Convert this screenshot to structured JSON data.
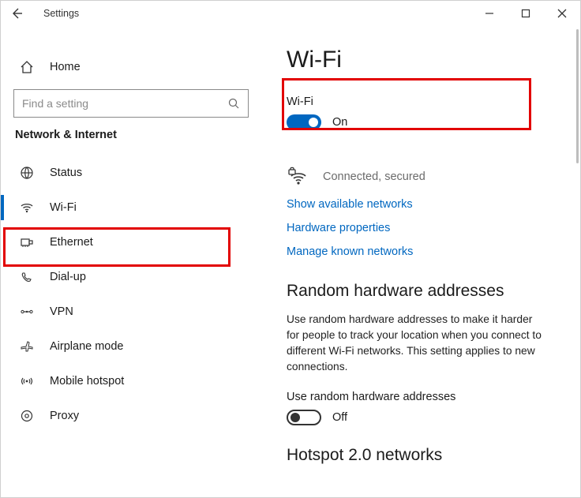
{
  "window": {
    "title": "Settings"
  },
  "sidebar": {
    "home": "Home",
    "search_placeholder": "Find a setting",
    "section": "Network & Internet",
    "items": [
      {
        "label": "Status"
      },
      {
        "label": "Wi-Fi",
        "active": true
      },
      {
        "label": "Ethernet"
      },
      {
        "label": "Dial-up"
      },
      {
        "label": "VPN"
      },
      {
        "label": "Airplane mode"
      },
      {
        "label": "Mobile hotspot"
      },
      {
        "label": "Proxy"
      }
    ]
  },
  "page": {
    "title": "Wi-Fi",
    "wifi_toggle": {
      "label": "Wi-Fi",
      "state_text": "On",
      "on": true
    },
    "connection_status": "Connected, secured",
    "links": {
      "show_networks": "Show available networks",
      "hw_props": "Hardware properties",
      "manage_known": "Manage known networks"
    },
    "random_hw": {
      "heading": "Random hardware addresses",
      "desc": "Use random hardware addresses to make it harder for people to track your location when you connect to different Wi-Fi networks. This setting applies to new connections.",
      "toggle_label": "Use random hardware addresses",
      "state_text": "Off"
    },
    "hotspot2": {
      "heading": "Hotspot 2.0 networks"
    }
  }
}
